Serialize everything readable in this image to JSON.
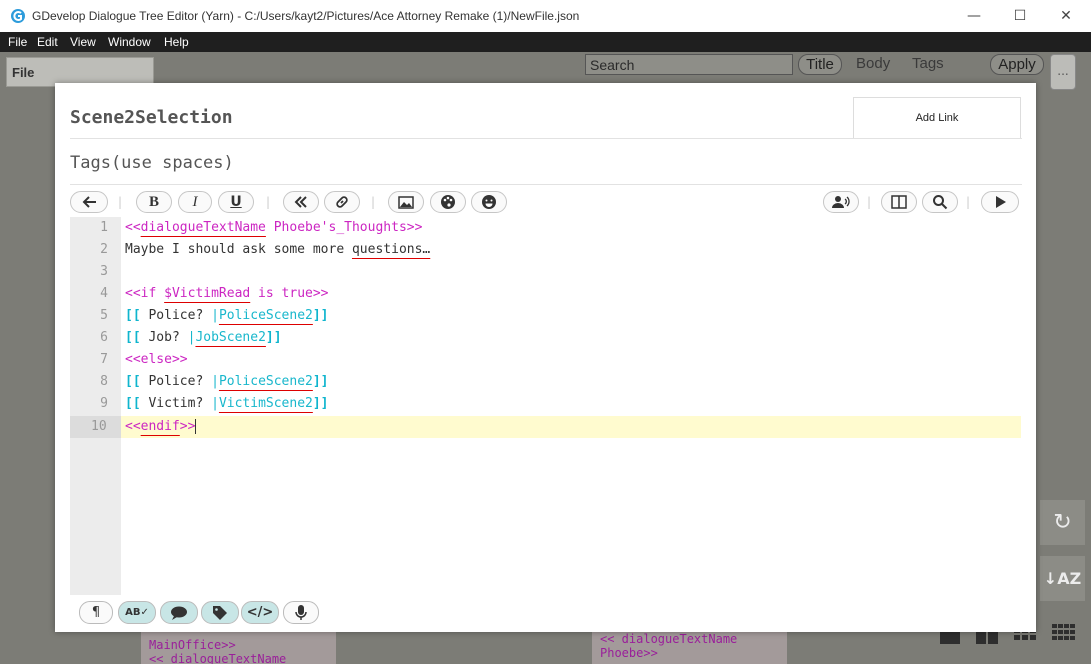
{
  "window": {
    "title": "GDevelop Dialogue Tree Editor (Yarn) - C:/Users/kayt2/Pictures/Ace Attorney Remake (1)/NewFile.json",
    "minimize_glyph": "—",
    "maximize_glyph": "☐",
    "close_glyph": "✕"
  },
  "menu": [
    "File",
    "Edit",
    "View",
    "Window",
    "Help"
  ],
  "toolbar": {
    "file_tab": "File",
    "search_placeholder": "Search",
    "title_label": "Title",
    "body_label": "Body",
    "tags_label": "Tags",
    "apply_label": "Apply",
    "menu_label": "..."
  },
  "editor": {
    "node_title": "Scene2Selection",
    "add_link_label": "Add Link",
    "tags_placeholder": "Tags(use spaces)",
    "lines": [
      "<<dialogueTextName Phoebe's_Thoughts>>",
      "Maybe I should ask some more questions…",
      "",
      "<<if $VictimRead is true>>",
      "[[ Police? |PoliceScene2]]",
      "[[ Job? |JobScene2]]",
      "<<else>>",
      "[[ Police? |PoliceScene2]]",
      "[[ Victim? |VictimScene2]]",
      "<<endif>>"
    ],
    "line_numbers": [
      "1",
      "2",
      "3",
      "4",
      "5",
      "6",
      "7",
      "8",
      "9",
      "10"
    ],
    "active_line": 10
  },
  "background_nodes": {
    "left_lines": [
      "MainOffice>>",
      "<< dialogueTextName"
    ],
    "right_lines": [
      "<< dialogueTextName",
      "Phoebe>>"
    ]
  },
  "icons": {
    "back": "arrow-left-icon",
    "bold": "bold-icon",
    "italic": "italic-icon",
    "underline": "underline-icon",
    "rewind": "double-chevron-left-icon",
    "link": "link-icon",
    "image": "image-icon",
    "palette": "palette-icon",
    "emoji": "emoji-icon",
    "speaker": "speaker-icon",
    "columns": "columns-icon",
    "search": "search-icon",
    "play": "play-icon"
  },
  "colors": {
    "command": "#cc26c2",
    "link": "#0fb5ce",
    "active_line": "#fffbcf",
    "menubar": "#1f1f1f"
  }
}
